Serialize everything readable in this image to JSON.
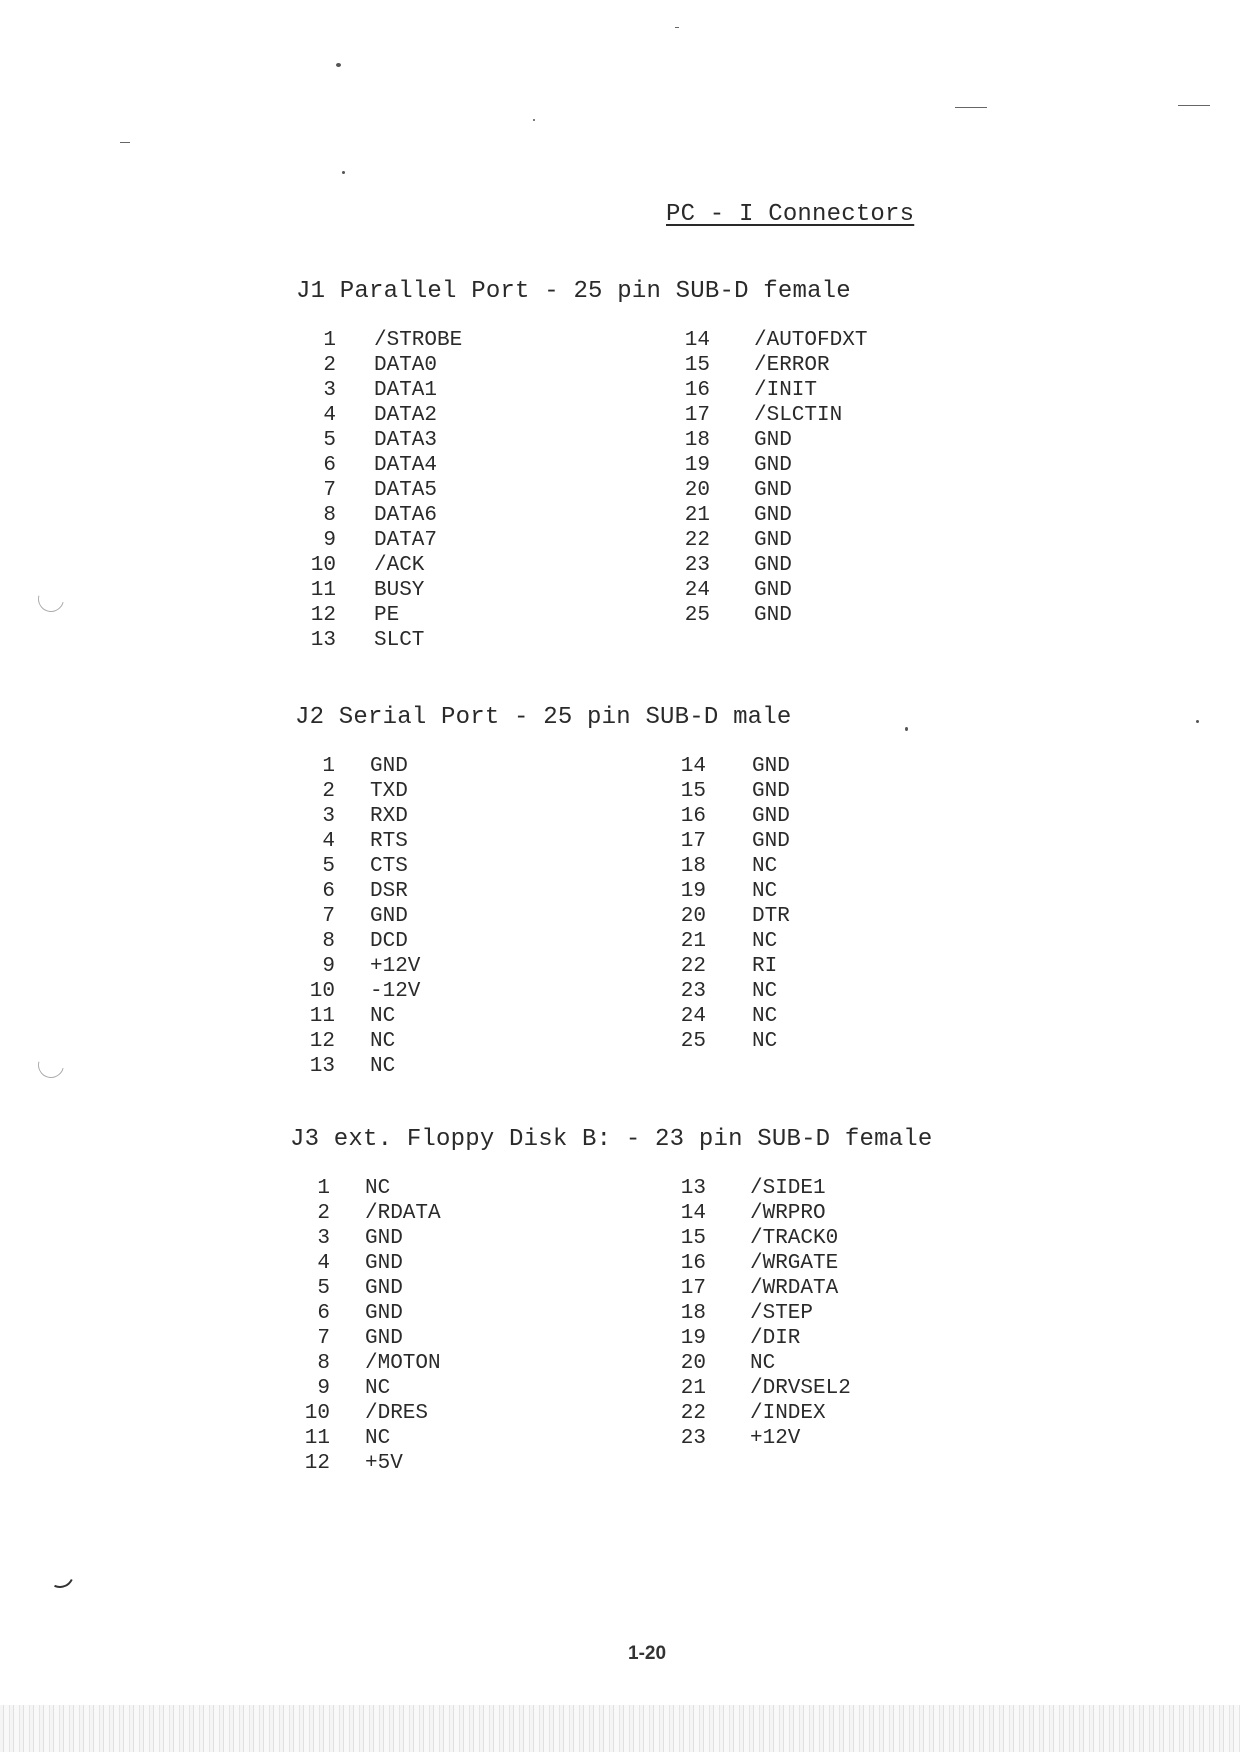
{
  "title": "PC - I Connectors",
  "page_number": "1-20",
  "sections": [
    {
      "heading": "J1 Parallel Port - 25 pin SUB-D female",
      "left": [
        {
          "pin": "1",
          "signal": "/STROBE"
        },
        {
          "pin": "2",
          "signal": "DATA0"
        },
        {
          "pin": "3",
          "signal": "DATA1"
        },
        {
          "pin": "4",
          "signal": "DATA2"
        },
        {
          "pin": "5",
          "signal": "DATA3"
        },
        {
          "pin": "6",
          "signal": "DATA4"
        },
        {
          "pin": "7",
          "signal": "DATA5"
        },
        {
          "pin": "8",
          "signal": "DATA6"
        },
        {
          "pin": "9",
          "signal": "DATA7"
        },
        {
          "pin": "10",
          "signal": "/ACK"
        },
        {
          "pin": "11",
          "signal": "BUSY"
        },
        {
          "pin": "12",
          "signal": "PE"
        },
        {
          "pin": "13",
          "signal": "SLCT"
        }
      ],
      "right": [
        {
          "pin": "14",
          "signal": "/AUTOFDXT"
        },
        {
          "pin": "15",
          "signal": "/ERROR"
        },
        {
          "pin": "16",
          "signal": "/INIT"
        },
        {
          "pin": "17",
          "signal": "/SLCTIN"
        },
        {
          "pin": "18",
          "signal": "GND"
        },
        {
          "pin": "19",
          "signal": "GND"
        },
        {
          "pin": "20",
          "signal": "GND"
        },
        {
          "pin": "21",
          "signal": "GND"
        },
        {
          "pin": "22",
          "signal": "GND"
        },
        {
          "pin": "23",
          "signal": "GND"
        },
        {
          "pin": "24",
          "signal": "GND"
        },
        {
          "pin": "25",
          "signal": "GND"
        }
      ]
    },
    {
      "heading": "J2 Serial Port - 25 pin SUB-D male",
      "left": [
        {
          "pin": "1",
          "signal": "GND"
        },
        {
          "pin": "2",
          "signal": "TXD"
        },
        {
          "pin": "3",
          "signal": "RXD"
        },
        {
          "pin": "4",
          "signal": "RTS"
        },
        {
          "pin": "5",
          "signal": "CTS"
        },
        {
          "pin": "6",
          "signal": "DSR"
        },
        {
          "pin": "7",
          "signal": "GND"
        },
        {
          "pin": "8",
          "signal": "DCD"
        },
        {
          "pin": "9",
          "signal": "+12V"
        },
        {
          "pin": "10",
          "signal": "-12V"
        },
        {
          "pin": "11",
          "signal": "NC"
        },
        {
          "pin": "12",
          "signal": "NC"
        },
        {
          "pin": "13",
          "signal": "NC"
        }
      ],
      "right": [
        {
          "pin": "14",
          "signal": "GND"
        },
        {
          "pin": "15",
          "signal": "GND"
        },
        {
          "pin": "16",
          "signal": "GND"
        },
        {
          "pin": "17",
          "signal": "GND"
        },
        {
          "pin": "18",
          "signal": "NC"
        },
        {
          "pin": "19",
          "signal": "NC"
        },
        {
          "pin": "20",
          "signal": "DTR"
        },
        {
          "pin": "21",
          "signal": "NC"
        },
        {
          "pin": "22",
          "signal": "RI"
        },
        {
          "pin": "23",
          "signal": "NC"
        },
        {
          "pin": "24",
          "signal": "NC"
        },
        {
          "pin": "25",
          "signal": "NC"
        }
      ]
    },
    {
      "heading": "J3 ext. Floppy Disk B: - 23 pin SUB-D female",
      "left": [
        {
          "pin": "1",
          "signal": "NC"
        },
        {
          "pin": "2",
          "signal": "/RDATA"
        },
        {
          "pin": "3",
          "signal": "GND"
        },
        {
          "pin": "4",
          "signal": "GND"
        },
        {
          "pin": "5",
          "signal": "GND"
        },
        {
          "pin": "6",
          "signal": "GND"
        },
        {
          "pin": "7",
          "signal": "GND"
        },
        {
          "pin": "8",
          "signal": "/MOTON"
        },
        {
          "pin": "9",
          "signal": "NC"
        },
        {
          "pin": "10",
          "signal": "/DRES"
        },
        {
          "pin": "11",
          "signal": "NC"
        },
        {
          "pin": "12",
          "signal": "+5V"
        }
      ],
      "right": [
        {
          "pin": "13",
          "signal": "/SIDE1"
        },
        {
          "pin": "14",
          "signal": "/WRPRO"
        },
        {
          "pin": "15",
          "signal": "/TRACK0"
        },
        {
          "pin": "16",
          "signal": "/WRGATE"
        },
        {
          "pin": "17",
          "signal": "/WRDATA"
        },
        {
          "pin": "18",
          "signal": "/STEP"
        },
        {
          "pin": "19",
          "signal": "/DIR"
        },
        {
          "pin": "20",
          "signal": "NC"
        },
        {
          "pin": "21",
          "signal": "/DRVSEL2"
        },
        {
          "pin": "22",
          "signal": "/INDEX"
        },
        {
          "pin": "23",
          "signal": "+12V"
        }
      ]
    }
  ]
}
